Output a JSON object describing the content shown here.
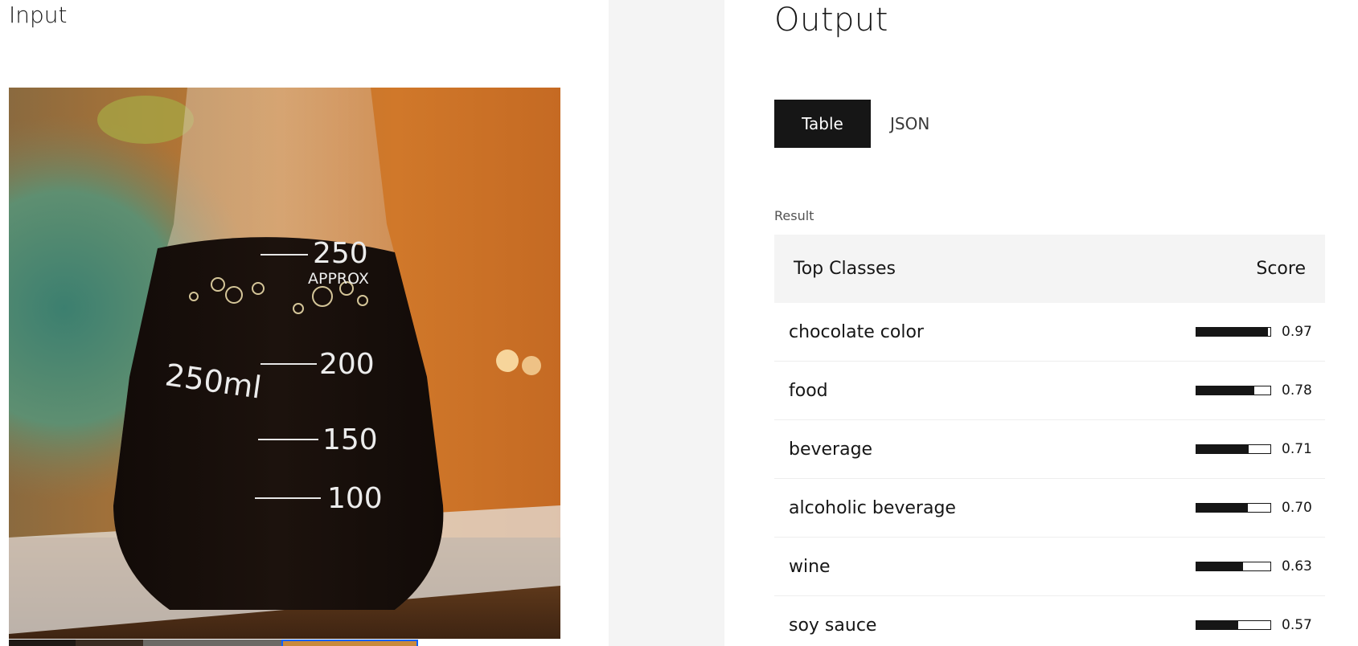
{
  "input": {
    "title": "Input"
  },
  "photo": {
    "flask_marks": [
      "250",
      "APPROX",
      "200",
      "150",
      "100"
    ],
    "flask_volume": "250ml"
  },
  "output": {
    "title": "Output",
    "tabs": [
      {
        "label": "Table",
        "active": true
      },
      {
        "label": "JSON",
        "active": false
      }
    ],
    "result_label": "Result",
    "table": {
      "headers": {
        "classes": "Top Classes",
        "score": "Score"
      },
      "rows": [
        {
          "label": "chocolate color",
          "score": "0.97",
          "value": 0.97
        },
        {
          "label": "food",
          "score": "0.78",
          "value": 0.78
        },
        {
          "label": "beverage",
          "score": "0.71",
          "value": 0.71
        },
        {
          "label": "alcoholic beverage",
          "score": "0.70",
          "value": 0.7
        },
        {
          "label": "wine",
          "score": "0.63",
          "value": 0.63
        },
        {
          "label": "soy sauce",
          "score": "0.57",
          "value": 0.57
        }
      ]
    }
  },
  "colors": {
    "tab_active_bg": "#161616",
    "table_header_bg": "#f4f4f4",
    "gutter_bg": "#f4f4f4",
    "bar_fill": "#161616"
  }
}
